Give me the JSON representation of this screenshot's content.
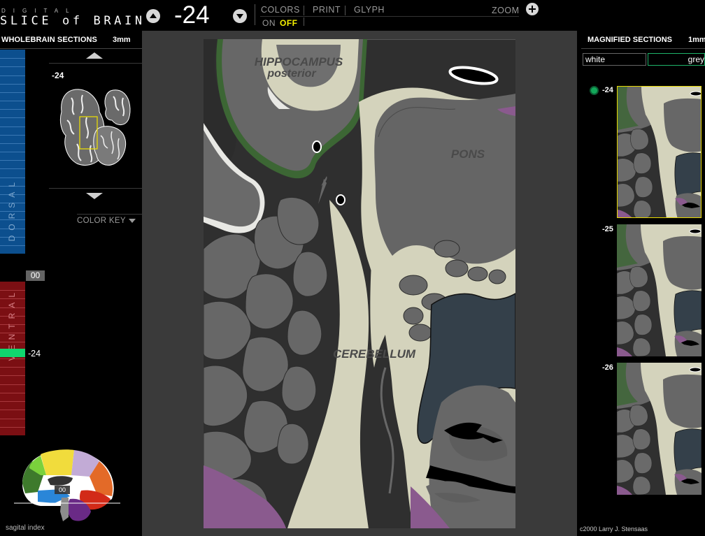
{
  "brand": {
    "subtitle": "DIGITAL",
    "title": "SLICE of BRAIN"
  },
  "toolbar": {
    "section_number": "-24",
    "colors_label": "COLORS",
    "print_label": "PRINT",
    "glyph_label": "GLYPH",
    "zoom_label": "ZOOM",
    "on_label": "ON",
    "off_label": "OFF",
    "up_icon": "chevron-up-icon",
    "down_icon": "chevron-down-icon",
    "zoom_icon": "plus-icon"
  },
  "wholebrain": {
    "title": "WHOLEBRAIN SECTIONS",
    "thickness": "3mm",
    "thumb_number": "-24",
    "color_key": "COLOR KEY",
    "dorsal_label": "DORSAL",
    "ventral_label": "VENTRAL",
    "zero_label": "00",
    "current_label": "-24",
    "sagittal_caption": "sagital index",
    "sagittal_marker": "00"
  },
  "main": {
    "labels": {
      "hippocampus": "HIPPOCAMPUS",
      "hippocampus_sub": "posterior",
      "pons": "PONS",
      "cerebellum": "CEREBELLUM"
    }
  },
  "magnified": {
    "title": "MAGNIFIED SECTIONS",
    "thickness": "1mm",
    "white_button": "white",
    "grey_button": "grey",
    "sections": [
      {
        "number": "-24",
        "active": true
      },
      {
        "number": "-25",
        "active": false
      },
      {
        "number": "-26",
        "active": false
      }
    ]
  },
  "footer": {
    "copyright": "c2000 Larry J. Stensaas"
  },
  "colors": {
    "white_matter": "#d4d3bc",
    "grey_matter": "#676767",
    "background": "#3a3a3a",
    "dorsal": "#0c4f8e",
    "ventral": "#7b0f13",
    "indicator": "#10d66e",
    "off_state": "#f6f200",
    "ventricle": "#34404a",
    "purple_region": "#8a5a8e",
    "green_region": "#3c6634"
  }
}
